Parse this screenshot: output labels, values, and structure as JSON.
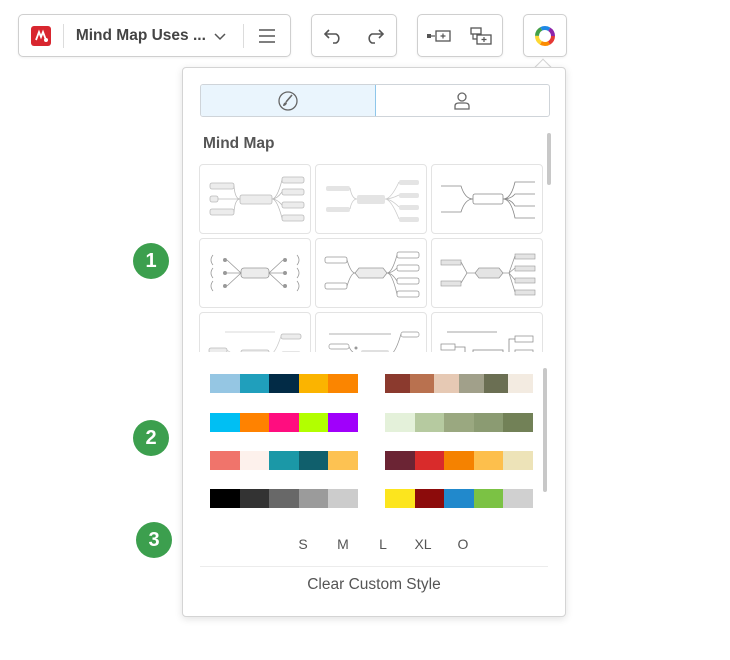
{
  "toolbar": {
    "doc_title": "Mind Map Uses ...",
    "app_icon": "mindmap-app-logo",
    "buttons": [
      "dropdown-chevron-icon",
      "menu-icon",
      "undo-icon",
      "redo-icon",
      "add-sibling-topic-icon",
      "add-subtopic-icon",
      "style-palette-icon"
    ]
  },
  "panel": {
    "tabs": [
      {
        "label": "",
        "icon": "brush-icon",
        "active": true
      },
      {
        "label": "",
        "icon": "person-icon",
        "active": false
      }
    ],
    "section_title": "Mind Map",
    "layouts_count": 9,
    "color_themes": [
      [
        "#95c6e3",
        "#209fbc",
        "#022b46",
        "#fbb400",
        "#fb8500"
      ],
      [
        "#8b3a2e",
        "#b9714f",
        "#e6c9b4",
        "#a1a08a",
        "#6b6f53",
        "#f3ebe1"
      ],
      [
        "#00bff3",
        "#ff8200",
        "#ff0d7f",
        "#b2ff00",
        "#a000fb"
      ],
      [
        "#e4f1da",
        "#b6caa0",
        "#9aa880",
        "#8b9b72",
        "#728157"
      ],
      [
        "#f0746b",
        "#fdf1ec",
        "#1b98a7",
        "#105f6c",
        "#fdc252"
      ],
      [
        "#6b2434",
        "#d92b2b",
        "#f58200",
        "#fdbf4c",
        "#ede3b8"
      ],
      [
        "#000000",
        "#333333",
        "#686868",
        "#9b9b9b",
        "#cccccc"
      ],
      [
        "#fce51e",
        "#8c0b0b",
        "#2189cc",
        "#7bc244",
        "#d0d0d0"
      ]
    ],
    "sizes": [
      "S",
      "M",
      "L",
      "XL",
      "O"
    ],
    "clear_label": "Clear Custom Style"
  },
  "callouts": [
    "1",
    "2",
    "3"
  ]
}
